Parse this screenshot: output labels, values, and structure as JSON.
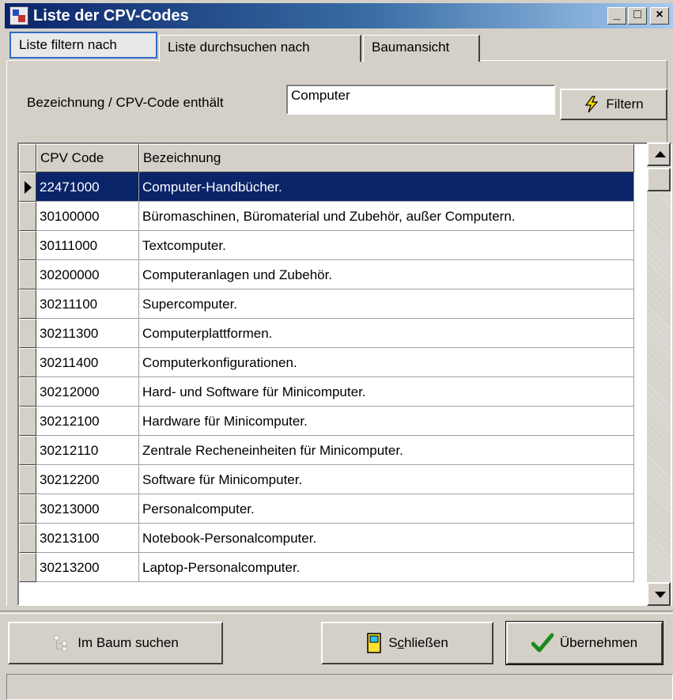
{
  "window": {
    "title": "Liste der CPV-Codes",
    "min": "_",
    "max": "□",
    "close": "×"
  },
  "tabs": [
    {
      "label": "Liste filtern nach",
      "active": true
    },
    {
      "label": "Liste durchsuchen nach",
      "active": false
    },
    {
      "label": "Baumansicht",
      "active": false
    }
  ],
  "filter": {
    "label": "Bezeichnung / CPV-Code enthält",
    "value": "Computer",
    "button_label": "Filtern"
  },
  "grid": {
    "columns": [
      "CPV Code",
      "Bezeichnung"
    ],
    "selected_index": 0,
    "rows": [
      {
        "code": "22471000",
        "name": "Computer-Handbücher."
      },
      {
        "code": "30100000",
        "name": "Büromaschinen, Büromaterial und Zubehör, außer Computern."
      },
      {
        "code": "30111000",
        "name": "Textcomputer."
      },
      {
        "code": "30200000",
        "name": "Computeranlagen und Zubehör."
      },
      {
        "code": "30211100",
        "name": "Supercomputer."
      },
      {
        "code": "30211300",
        "name": "Computerplattformen."
      },
      {
        "code": "30211400",
        "name": "Computerkonfigurationen."
      },
      {
        "code": "30212000",
        "name": "Hard- und Software für Minicomputer."
      },
      {
        "code": "30212100",
        "name": "Hardware für Minicomputer."
      },
      {
        "code": "30212110",
        "name": "Zentrale Recheneinheiten für Minicomputer."
      },
      {
        "code": "30212200",
        "name": "Software für Minicomputer."
      },
      {
        "code": "30213000",
        "name": "Personalcomputer."
      },
      {
        "code": "30213100",
        "name": "Notebook-Personalcomputer."
      },
      {
        "code": "30213200",
        "name": "Laptop-Personalcomputer."
      }
    ]
  },
  "footer": {
    "tree_button": "Im Baum suchen",
    "close_button_pre": "S",
    "close_button_accel": "c",
    "close_button_post": "hließen",
    "apply_button": "Übernehmen"
  },
  "colors": {
    "selection": "#0a246a",
    "title_start": "#0a246a",
    "face": "#d4d0c8"
  },
  "icons": [
    "app-icon",
    "lightning-icon",
    "tree-icon",
    "door-icon",
    "checkmark-icon"
  ]
}
